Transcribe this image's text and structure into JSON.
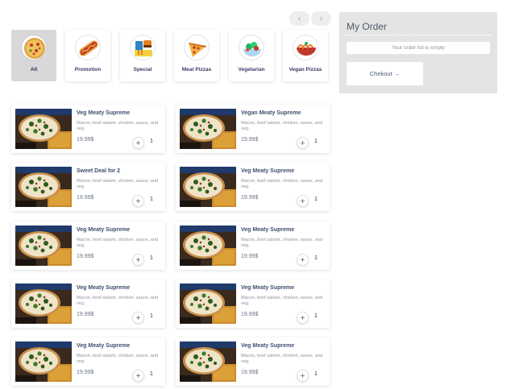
{
  "nav": {
    "prev_icon": "‹",
    "next_icon": "›"
  },
  "categories": [
    {
      "label": "All",
      "icon": "pizza-icon",
      "active": true
    },
    {
      "label": "Promotion",
      "icon": "hotdog-icon",
      "active": false
    },
    {
      "label": "Special",
      "icon": "combo-meal-icon",
      "active": false
    },
    {
      "label": "Meat Pizzas",
      "icon": "pizza-slice-icon",
      "active": false
    },
    {
      "label": "Vegetarian",
      "icon": "vegetarian-salad-icon",
      "active": false
    },
    {
      "label": "Vegan Pizzas",
      "icon": "vegan-bowl-icon",
      "active": false
    }
  ],
  "order": {
    "title": "My Order",
    "empty_text": "Your order list is empty",
    "checkout_label": "Chekout →"
  },
  "products": [
    {
      "name": "Veg Meaty Supreme",
      "desc": "Macon, boof salami, chicken, sauce, and veg.",
      "price": "19.99$",
      "qty": "1",
      "add": "+"
    },
    {
      "name": "Vegan Meaty Supreme",
      "desc": "Macon, boof salami, chicken, sauce, and veg.",
      "price": "19.99$",
      "qty": "1",
      "add": "+"
    },
    {
      "name": "Sweet Deal for 2",
      "desc": "Macon, boof salami, chicken, sauce, and veg.",
      "price": "19.99$",
      "qty": "1",
      "add": "+"
    },
    {
      "name": "Veg Meaty Supreme",
      "desc": "Macon, boof salami, chicken, sauce, and veg.",
      "price": "19.99$",
      "qty": "1",
      "add": "+"
    },
    {
      "name": "Veg Meaty Supreme",
      "desc": "Macon, boof salami, chicken, sauce, and veg.",
      "price": "19.99$",
      "qty": "1",
      "add": "+"
    },
    {
      "name": "Veg Meaty Supreme",
      "desc": "Macon, boof salami, chicken, sauce, and veg.",
      "price": "19.99$",
      "qty": "1",
      "add": "+"
    },
    {
      "name": "Veg Meaty Supreme",
      "desc": "Macon, boof salami, chicken, sauce, and veg.",
      "price": "19.99$",
      "qty": "1",
      "add": "+"
    },
    {
      "name": "Veg Meaty Supreme",
      "desc": "Macon, boof salami, chicken, sauce, and veg.",
      "price": "19.99$",
      "qty": "1",
      "add": "+"
    },
    {
      "name": "Veg Meaty Supreme",
      "desc": "Macon, boof salami, chicken, sauce, and veg.",
      "price": "19.99$",
      "qty": "1",
      "add": "+"
    },
    {
      "name": "Veg Meaty Supreme",
      "desc": "Macon, boof salami, chicken, sauce, and veg.",
      "price": "19.99$",
      "qty": "1",
      "add": "+"
    }
  ]
}
